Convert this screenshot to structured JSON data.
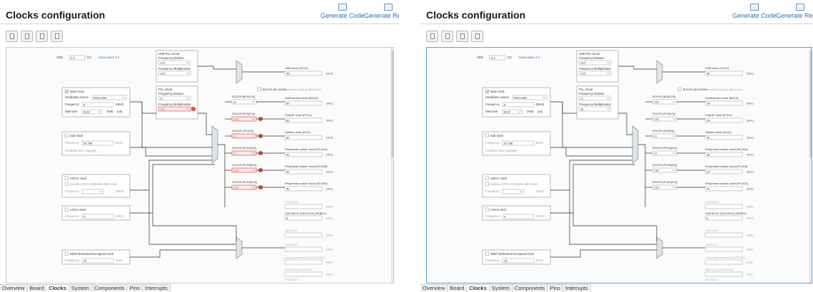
{
  "header": {
    "title": "Clocks configuration",
    "generate_code": "Generate Code",
    "generate_report": "Generate Report"
  },
  "tabs": [
    "Overview",
    "Board",
    "Clocks",
    "System",
    "Components",
    "Pins",
    "Interrupts"
  ],
  "active_tab": "Clocks",
  "diagram": {
    "vdd_label": "VDD",
    "vdd_value": "3.3",
    "vdd_unit": "(V)",
    "vdd_actual": "Actual value 3.3",
    "usb_pll": {
      "title": "USB PLL circuit",
      "freq_div": "Frequency Division",
      "div_val": "x1/2",
      "freq_mult": "Frequency Multiplication",
      "mult_val": "x1/2"
    },
    "main_clock": {
      "title": "Main clock",
      "osc_src": "Oscillation source",
      "osc_val": "Resonator",
      "freq_label": "Frequency",
      "freq_val": "8",
      "freq_unit": "(MHz)",
      "wait_label": "Wait time",
      "wait_val": "8192",
      "wait_cycles": "2048",
      "wait_unit": "(us)"
    },
    "pll": {
      "title": "PLL circuit",
      "freq_div": "Frequency Division",
      "div_val": "x1",
      "freq_mult": "Frequency Multiplication",
      "mult_val_a": "x15",
      "mult_val_b": "x6"
    },
    "sub_clock": {
      "title": "Sub-clock",
      "freq_label": "Frequency",
      "freq_val": "32.768",
      "freq_unit": "(kHz)",
      "drive_label": "Oscillator drive capacity"
    },
    "hoco": {
      "title": "HOCO clock",
      "enable_label": "Enable HOCO oscillation after reset",
      "freq_label": "Frequency",
      "freq_unit": "(MHz)"
    },
    "loco": {
      "title": "LOCO clock",
      "freq_label": "Frequency",
      "freq_val": "4",
      "freq_unit": "(MHz)"
    },
    "iwdt": {
      "title": "IWDT-dedicated low-speed clock",
      "freq_label": "Frequency",
      "freq_val": "15",
      "freq_unit": "(kHz)"
    },
    "external_bus_pin": "External bus clock pin (BCLK pin)",
    "bckcr": "BCKCR (BCLKDIV)",
    "dividers": [
      "SCKCR (BCK[3:0])",
      "SCKCR (FCK[3:0])",
      "SCKCR (ICK[3:0])",
      "SCKCR (PCKA[3:0])",
      "SCKCR (PCKB[3:0])",
      "SCKCR (PCKD[3:0])"
    ],
    "div_values_a": [
      "x1",
      "x1/2",
      "x1",
      "x1",
      "x1/2",
      "x1/2"
    ],
    "div_values_b": [
      "x1/2",
      "x1/2",
      "x1",
      "x1",
      "x1/2",
      "x1/2"
    ],
    "outputs": [
      {
        "label": "USB clock (UCLK)",
        "val_a": "48",
        "val_b": "48",
        "unit": "(MHz)"
      },
      {
        "label": "External bus clock (BCLK)",
        "val_a": "60",
        "val_b": "24",
        "unit": "(MHz)"
      },
      {
        "label": "FlashIF clock (FCLK)",
        "val_a": "60",
        "val_b": "24",
        "unit": "(MHz)"
      },
      {
        "label": "System clock (ICLK)",
        "val_a": "60",
        "val_b": "48",
        "unit": "(MHz)"
      },
      {
        "label": "Peripheral module clock (PCLKA)",
        "val_a": "60",
        "val_b": "48",
        "unit": "(MHz)"
      },
      {
        "label": "Peripheral module clock (PCLKB)",
        "val_a": "40",
        "val_b": "24",
        "unit": "(MHz)"
      },
      {
        "label": "Peripheral module clock (PCLKD)",
        "val_a": "40",
        "val_b": "24",
        "unit": "(MHz)"
      }
    ],
    "lower_outputs": [
      {
        "label": "CACHCLK",
        "val": "",
        "unit": "(MHz)"
      },
      {
        "label": "CAN MCLK (CACHCLK) (SEBDC)",
        "val": "8",
        "unit": "(MHz)"
      },
      {
        "label": "CACKCLK",
        "val": "",
        "unit": "(MHz)"
      },
      {
        "label": "CACKCLK",
        "val": "",
        "unit": "(MHz)"
      },
      {
        "label": "Low-power timer clock (LPTCLK)",
        "val": "",
        "unit": "(kHz)"
      },
      {
        "label": "IWDTCLK (CACHCLK)",
        "val": "",
        "unit": "(kHz)"
      },
      {
        "label": "RTCSCLK",
        "val": "",
        "unit": "(kHz)"
      }
    ]
  },
  "colors": {
    "accent": "#2b6fb6",
    "error": "#d43a2f",
    "line": "#2b2b2b",
    "canvas": "#fbfbfb"
  }
}
